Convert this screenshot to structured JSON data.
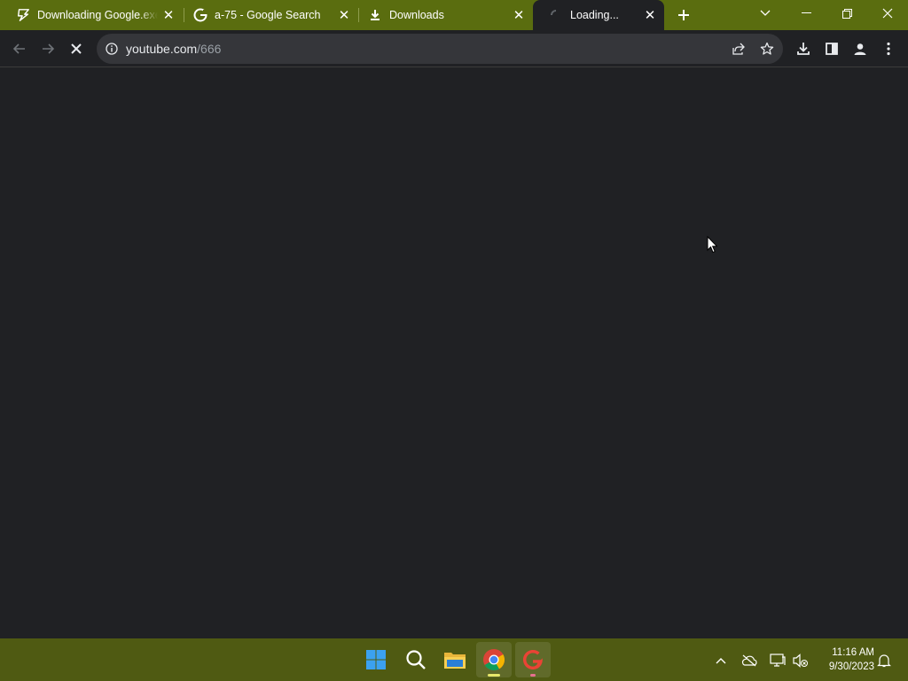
{
  "tabs": [
    {
      "title": "Downloading Google.exe",
      "favicon": "lightning-icon"
    },
    {
      "title": "a-75 - Google Search",
      "favicon": "google-g-icon"
    },
    {
      "title": "Downloads",
      "favicon": "download-icon"
    },
    {
      "title": "Loading...",
      "favicon": "loading-icon",
      "active": true
    }
  ],
  "toolbar": {
    "url_host": "youtube.com",
    "url_path": "/666"
  },
  "taskbar": {
    "time": "11:16 AM",
    "date": "9/30/2023"
  },
  "colors": {
    "titlebar": "#5a6d0f",
    "taskbar": "#4f5a12",
    "page_bg": "#202124"
  }
}
